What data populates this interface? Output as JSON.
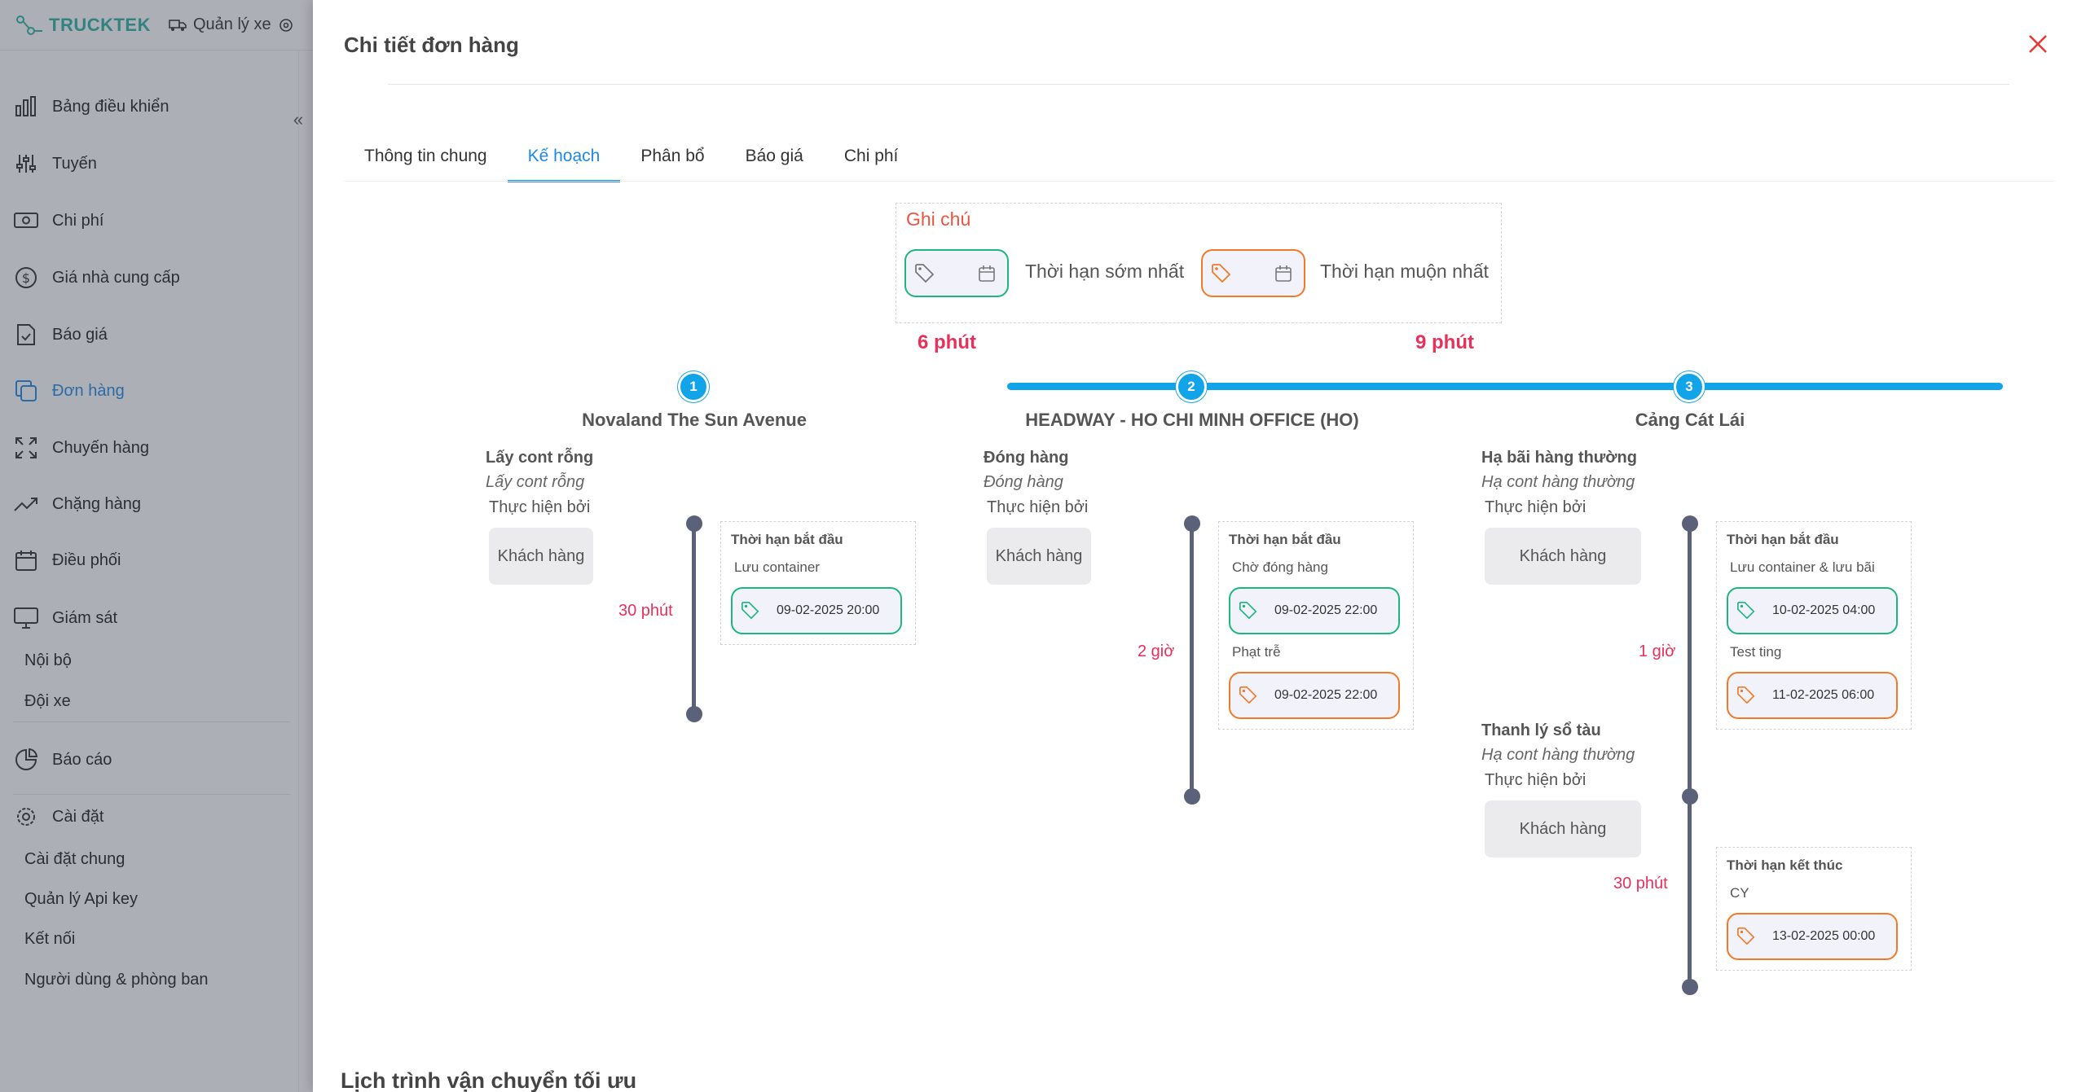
{
  "app": {
    "brand": "TRUCKTEK",
    "topnav": "Quản lý xe",
    "sidebar": [
      {
        "label": "Bảng điều khiển",
        "icon": "bar-chart-icon"
      },
      {
        "label": "Tuyến",
        "icon": "sliders-icon"
      },
      {
        "label": "Chi phí",
        "icon": "money-icon"
      },
      {
        "label": "Giá nhà cung cấp",
        "icon": "dollar-circle-icon"
      },
      {
        "label": "Báo giá",
        "icon": "document-check-icon"
      },
      {
        "label": "Đơn hàng",
        "icon": "copy-icon",
        "active": true
      },
      {
        "label": "Chuyến hàng",
        "icon": "expand-icon"
      },
      {
        "label": "Chặng hàng",
        "icon": "trend-icon"
      },
      {
        "label": "Điều phối",
        "icon": "calendar-icon"
      },
      {
        "label": "Giám sát",
        "icon": "monitor-icon"
      }
    ],
    "monitor_sub": [
      "Nội bộ",
      "Đội xe"
    ],
    "report": "Báo cáo",
    "settings": "Cài đặt",
    "settings_sub": [
      "Cài đặt chung",
      "Quản lý Api key",
      "Kết nối",
      "Người dùng & phòng ban"
    ]
  },
  "panel": {
    "title": "Chi tiết đơn hàng",
    "tabs": [
      "Thông tin chung",
      "Kế hoạch",
      "Phân bổ",
      "Báo giá",
      "Chi phí"
    ],
    "active_tab": "Kế hoạch",
    "note": {
      "label": "Ghi chú",
      "earliest": "Thời hạn sớm nhất",
      "latest": "Thời hạn muộn nhất"
    },
    "gap_top": [
      "6 phút",
      "9 phút"
    ],
    "stops": [
      {
        "num": "1",
        "name": "Novaland The Sun Avenue"
      },
      {
        "num": "2",
        "name": "HEADWAY - HO CHI MINH OFFICE (HO)"
      },
      {
        "num": "3",
        "name": "Cảng Cát Lái"
      }
    ],
    "stop1": {
      "action_bold": "Lấy cont rỗng",
      "action_italic": "Lấy cont rỗng",
      "performed_by": "Thực hiện bởi",
      "customer": "Khách hàng",
      "duration": "30 phút",
      "box_title": "Thời hạn bắt đầu",
      "label1": "Lưu container",
      "date1": "09-02-2025 20:00"
    },
    "stop2": {
      "action_bold": "Đóng hàng",
      "action_italic": "Đóng hàng",
      "performed_by": "Thực hiện bởi",
      "customer": "Khách hàng",
      "duration": "2 giờ",
      "box_title": "Thời hạn bắt đầu",
      "label1": "Chờ đóng hàng",
      "date1": "09-02-2025 22:00",
      "label2": "Phạt trễ",
      "date2": "09-02-2025 22:00"
    },
    "stop3a": {
      "action_bold": "Hạ bãi hàng thường",
      "action_italic": "Hạ cont hàng thường",
      "performed_by": "Thực hiện bởi",
      "customer": "Khách hàng",
      "duration": "1 giờ",
      "box_title": "Thời hạn bắt đầu",
      "label1": "Lưu container & lưu bãi",
      "date1": "10-02-2025 04:00",
      "label2": "Test ting",
      "date2": "11-02-2025 06:00"
    },
    "stop3b": {
      "action_bold": "Thanh lý sổ tàu",
      "action_italic": "Hạ cont hàng thường",
      "performed_by": "Thực hiện bởi",
      "customer": "Khách hàng",
      "duration": "30 phút",
      "box_title": "Thời hạn kết thúc",
      "label1": "CY",
      "date1": "13-02-2025 00:00"
    },
    "section_title": "Lịch trình vận chuyển tối ưu"
  }
}
